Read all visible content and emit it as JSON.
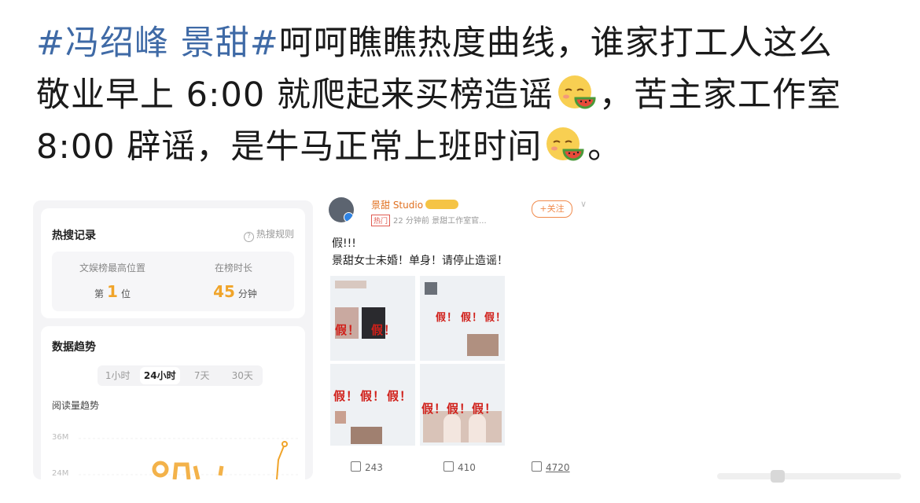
{
  "post": {
    "hashtag": "#冯绍峰 景甜#",
    "line1": "呵呵瞧瞧热度曲线，谁家打工人这么",
    "line2a": "敬业早上 6:00 就爬起来买榜造谣",
    "line2b": "，苦主家工作室",
    "line3a": "8:00 辟谣，是牛马正常上班时间",
    "line3b": "。",
    "emoji_icon": "melon-eating-emoji"
  },
  "hot_search": {
    "title": "热搜记录",
    "rules_label": "热搜规则",
    "rank_label": "文娱榜最高位置",
    "rank_prefix": "第",
    "rank_value": "1",
    "rank_suffix": "位",
    "duration_label": "在榜时长",
    "duration_value": "45",
    "duration_unit": "分钟"
  },
  "trend": {
    "title": "数据趋势",
    "tabs": [
      "1小时",
      "24小时",
      "7天",
      "30天"
    ],
    "active_tab": "24小时",
    "subtitle": "阅读量趋势",
    "y_ticks": [
      "36M",
      "24M"
    ]
  },
  "weibo": {
    "username": "景甜 Studio",
    "hot_tag": "热门",
    "time_source": "22 分钟前  景甜工作室官...",
    "follow_label": "+关注",
    "text1": "假!!!",
    "text2": "景甜女士未婚！单身！请停止造谣！",
    "fake_stamp": "假！",
    "repost_count": "243",
    "comment_count": "410",
    "like_count": "4720"
  },
  "colors": {
    "hashtag": "#3f6aa6",
    "accent_orange": "#f0a42a",
    "weibo_orange": "#f08a4b",
    "stamp_red": "#d0201a"
  }
}
